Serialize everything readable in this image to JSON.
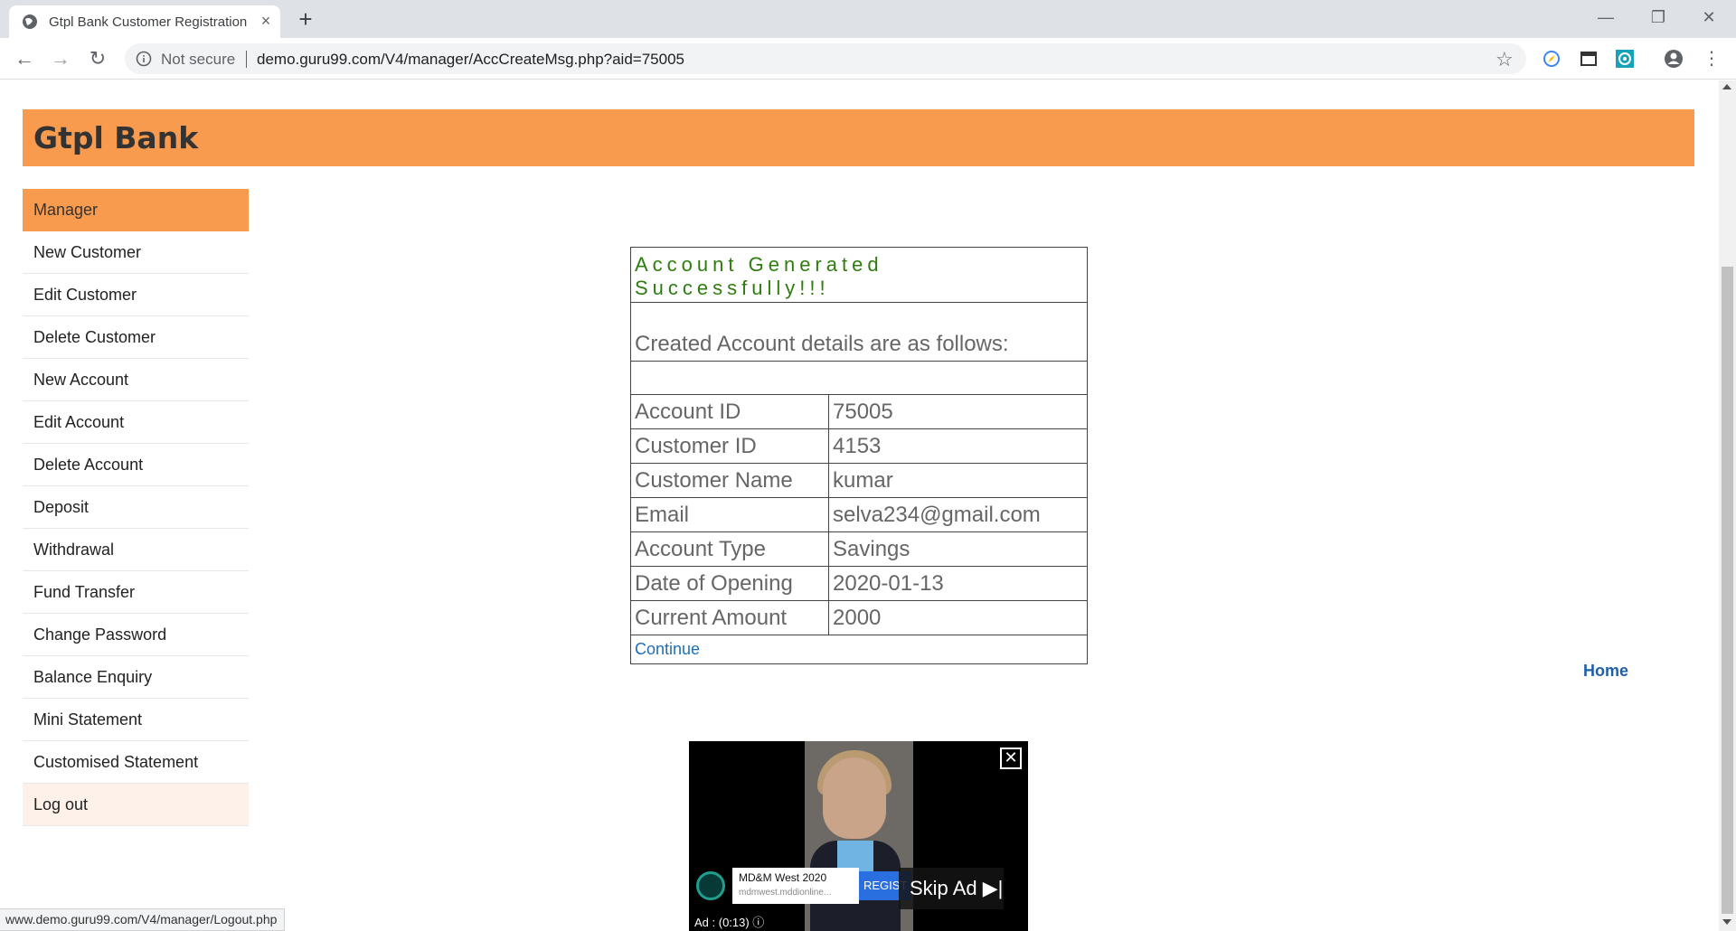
{
  "browser": {
    "tab_title": "Gtpl Bank Customer Registration",
    "tab_close": "×",
    "new_tab": "+",
    "security_label": "Not secure",
    "url": "demo.guru99.com/V4/manager/AccCreateMsg.php?aid=75005",
    "status_url": "www.demo.guru99.com/V4/manager/Logout.php"
  },
  "header": {
    "brand": "Gtpl Bank"
  },
  "menu": {
    "items": [
      {
        "label": "Manager"
      },
      {
        "label": "New Customer"
      },
      {
        "label": "Edit Customer"
      },
      {
        "label": "Delete Customer"
      },
      {
        "label": "New Account"
      },
      {
        "label": "Edit Account"
      },
      {
        "label": "Delete Account"
      },
      {
        "label": "Deposit"
      },
      {
        "label": "Withdrawal"
      },
      {
        "label": "Fund Transfer"
      },
      {
        "label": "Change Password"
      },
      {
        "label": "Balance Enquiry"
      },
      {
        "label": "Mini Statement"
      },
      {
        "label": "Customised Statement"
      },
      {
        "label": "Log out"
      }
    ]
  },
  "account": {
    "heading": "Account Generated Successfully!!!",
    "subheading": "Created Account details are as follows:",
    "rows": [
      {
        "label": "Account ID",
        "value": "75005"
      },
      {
        "label": "Customer ID",
        "value": "4153"
      },
      {
        "label": "Customer Name",
        "value": "kumar"
      },
      {
        "label": "Email",
        "value": "selva234@gmail.com"
      },
      {
        "label": "Account Type",
        "value": "Savings"
      },
      {
        "label": "Date of Opening",
        "value": "2020-01-13"
      },
      {
        "label": "Current Amount",
        "value": "2000"
      }
    ],
    "continue_label": "Continue"
  },
  "home_link": "Home",
  "ad": {
    "advertiser": "MD&M West 2020",
    "domain": "mdmwest.mddionline...",
    "register": "REGIST",
    "skip": "Skip Ad ▶|",
    "timer": "Ad : (0:13)  ⓘ"
  },
  "colors": {
    "header_orange": "#f99b4e",
    "success_green": "#2e7d0f",
    "link_blue": "#1e6fb8"
  }
}
